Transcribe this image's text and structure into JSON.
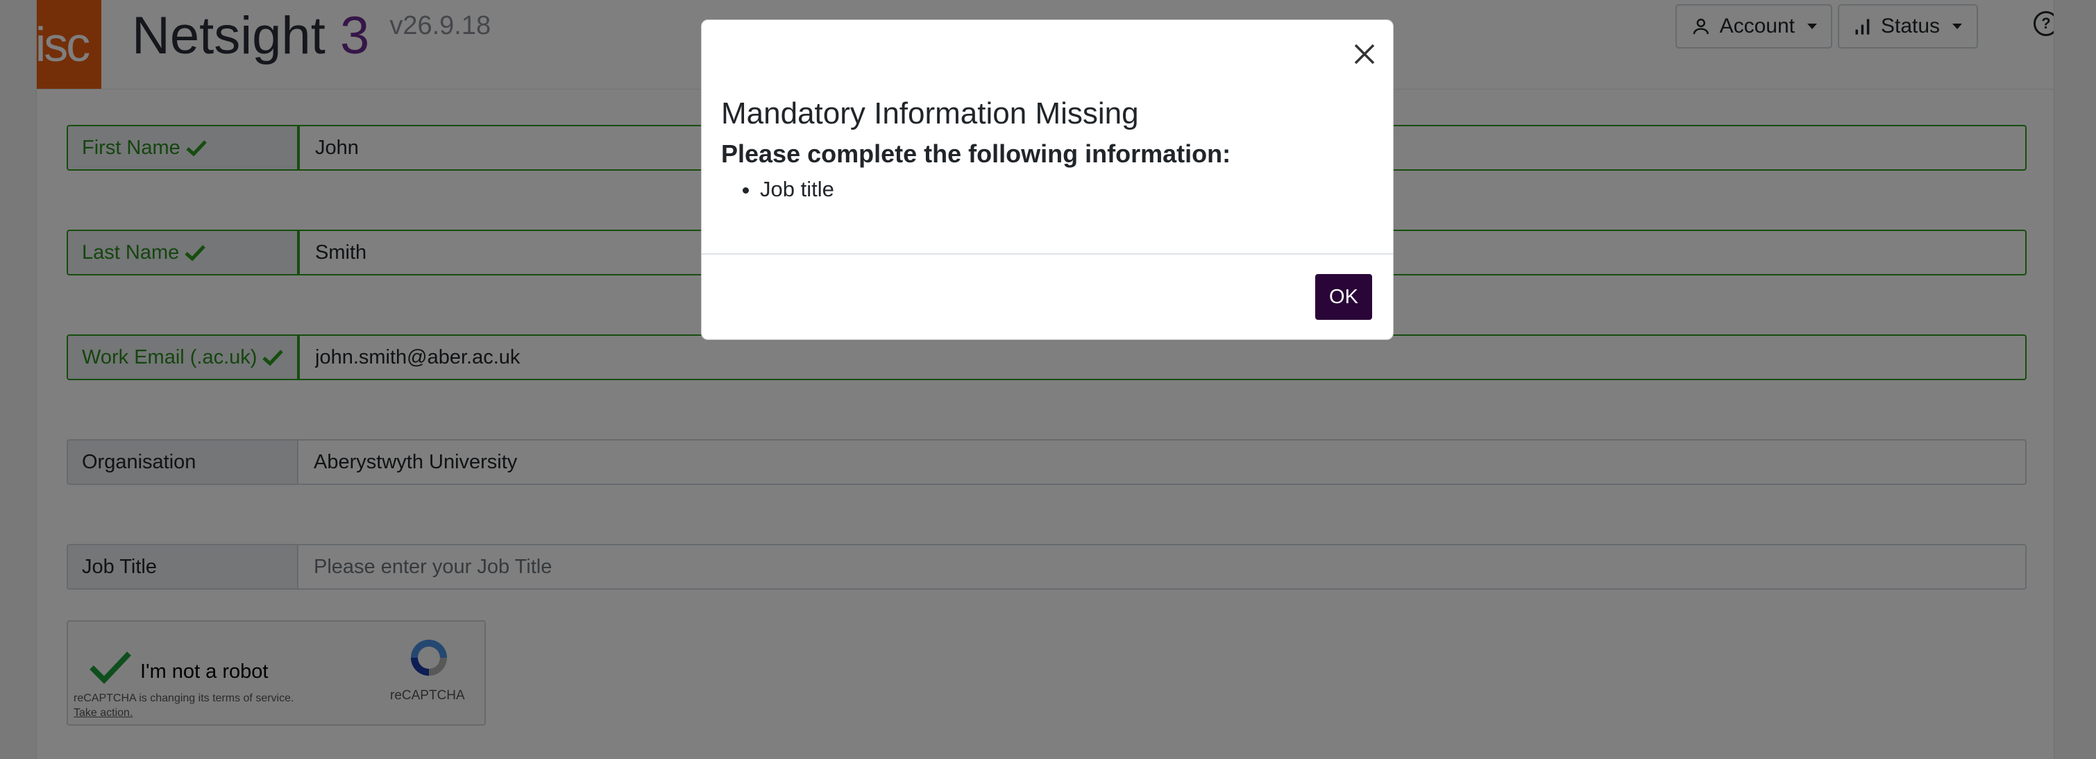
{
  "header": {
    "logo_text": "Jisc",
    "app_name": "Netsight",
    "app_number": "3",
    "version": "v26.9.18",
    "account_label": "Account",
    "status_label": "Status",
    "help_symbol": "?"
  },
  "form": {
    "first_name_label": "First Name",
    "first_name_value": "John",
    "last_name_label": "Last Name",
    "last_name_value": "Smith",
    "email_label": "Work Email (.ac.uk)",
    "email_value": "john.smith@aber.ac.uk",
    "organisation_label": "Organisation",
    "organisation_value": "Aberystwyth University",
    "job_title_label": "Job Title",
    "job_title_placeholder": "Please enter your Job Title"
  },
  "captcha": {
    "label": "I'm not a robot",
    "terms": "reCAPTCHA is changing its terms of service.",
    "action": "Take action.",
    "brand": "reCAPTCHA"
  },
  "modal": {
    "title": "Mandatory Information Missing",
    "subtitle": "Please complete the following information:",
    "items": [
      "Job title"
    ],
    "ok_label": "OK"
  },
  "colors": {
    "brand_orange": "#e85e13",
    "brand_purple": "#6b2c91",
    "valid_green": "#2f9a1f",
    "ok_button": "#2a0538"
  }
}
